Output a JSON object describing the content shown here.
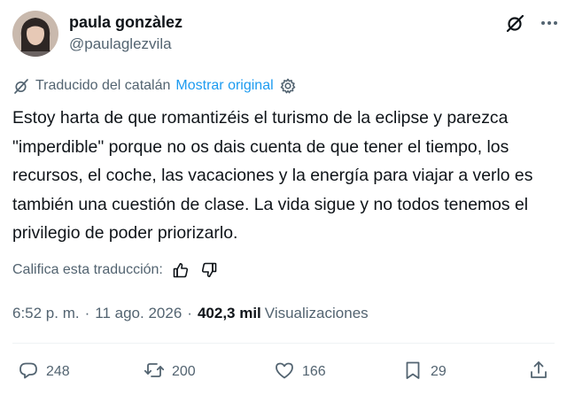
{
  "author": {
    "display_name": "paula gonzàlez",
    "handle": "@paulaglezvila"
  },
  "translation": {
    "translated_from": "Traducido del catalán",
    "show_original": "Mostrar original"
  },
  "tweet": {
    "text": "Estoy harta de que romantizéis el turismo de la eclipse y parezca \"imperdible\" porque no os dais cuenta de que tener el tiempo, los recursos, el coche, las vacaciones y la energía para viajar a verlo es también una cuestión de clase. La vida sigue y no todos tenemos el privilegio de poder priorizarlo."
  },
  "rating": {
    "label": "Califica esta traducción:"
  },
  "meta": {
    "time": "6:52 p. m.",
    "separator1": "·",
    "date": "11 ago. 2026",
    "separator2": "·",
    "views_count": "402,3 mil",
    "views_label": "Visualizaciones"
  },
  "actions": {
    "replies": "248",
    "reposts": "200",
    "likes": "166",
    "bookmarks": "29"
  },
  "icons": {
    "grok": "grok-icon",
    "more": "more-icon",
    "translate": "translate-icon",
    "settings": "settings-icon",
    "thumb_up": "thumb-up-icon",
    "thumb_down": "thumb-down-icon",
    "reply": "reply-icon",
    "repost": "repost-icon",
    "like": "heart-icon",
    "bookmark": "bookmark-icon",
    "share": "share-icon"
  },
  "colors": {
    "text": "#0f1419",
    "secondary": "#536471",
    "link": "#1d9bf0"
  }
}
